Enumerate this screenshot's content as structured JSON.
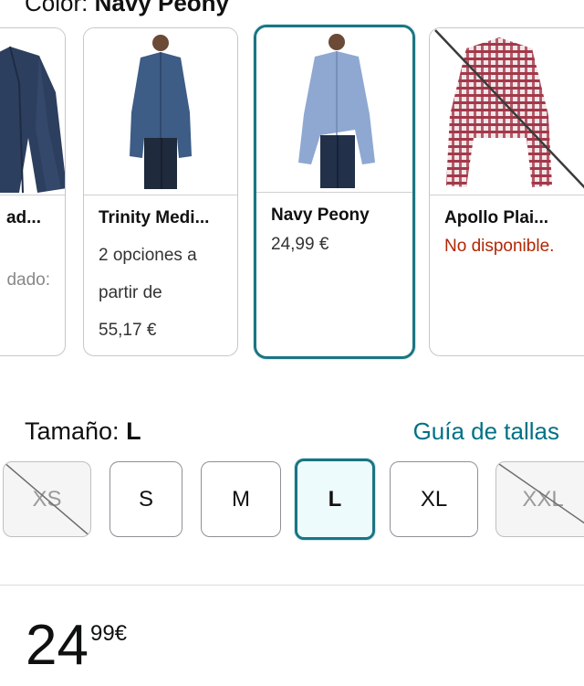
{
  "color": {
    "label": "Color:",
    "value": "Navy Peony"
  },
  "swatches": [
    {
      "name": "ad...",
      "sub": "dado:"
    },
    {
      "name": "Trinity Medi...",
      "sub_lines": [
        "2 opciones a",
        "partir de",
        "55,17 €"
      ]
    },
    {
      "name": "Navy Peony",
      "price": "24,99 €",
      "selected": true
    },
    {
      "name": "Apollo Plai...",
      "status": "No disponible."
    }
  ],
  "size": {
    "label": "Tamaño:",
    "value": "L",
    "guide_link": "Guía de tallas"
  },
  "sizes": [
    {
      "label": "XS",
      "available": false
    },
    {
      "label": "S",
      "available": true
    },
    {
      "label": "M",
      "available": true
    },
    {
      "label": "L",
      "available": true,
      "selected": true
    },
    {
      "label": "XL",
      "available": true
    },
    {
      "label": "XXL",
      "available": false
    }
  ],
  "price": {
    "whole": "24",
    "fraction": "99",
    "currency": "€"
  },
  "colors": {
    "accent": "#007185",
    "selected_border": "#1a7583",
    "unavailable": "#b12704"
  }
}
